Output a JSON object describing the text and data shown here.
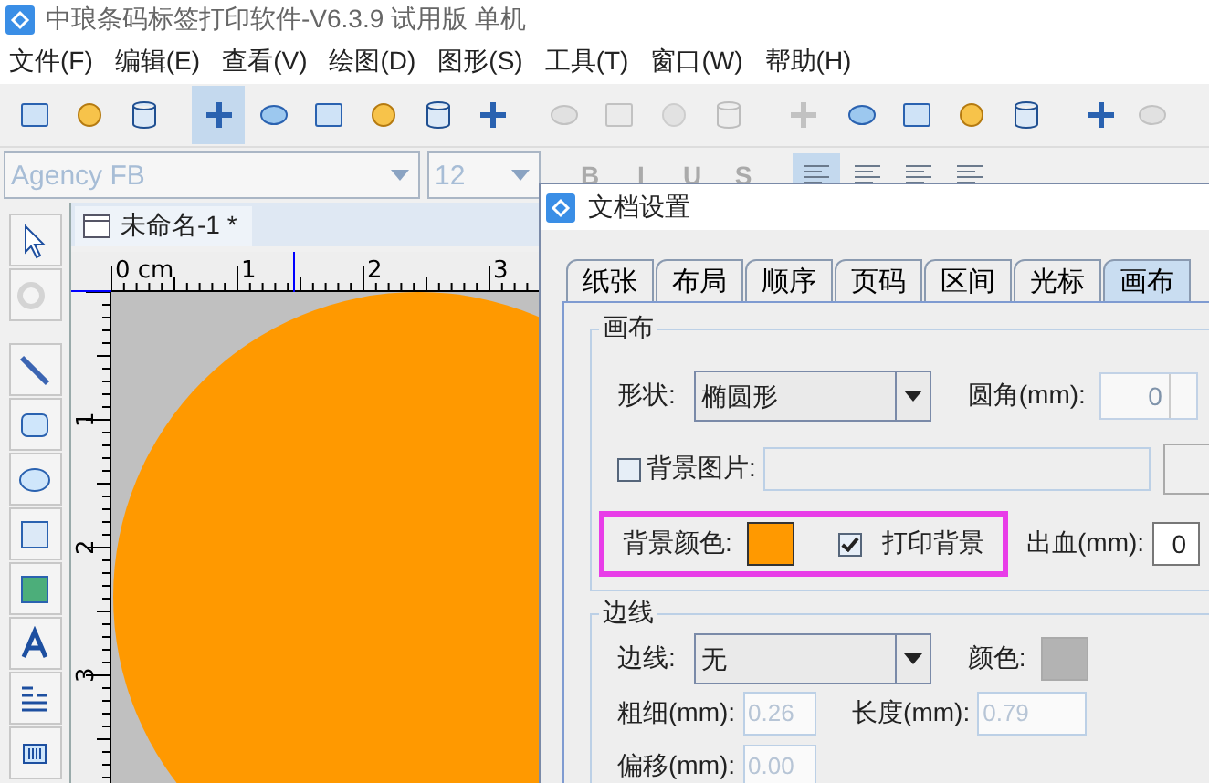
{
  "window": {
    "title": "中琅条码标签打印软件-V6.3.9 试用版 单机"
  },
  "menu": [
    "文件(F)",
    "编辑(E)",
    "查看(V)",
    "绘图(D)",
    "图形(S)",
    "工具(T)",
    "窗口(W)",
    "帮助(H)"
  ],
  "toolbar": [
    {
      "selected": false,
      "disabled": false
    },
    {
      "selected": false,
      "disabled": false
    },
    {
      "selected": false,
      "disabled": false
    },
    {
      "selected": true,
      "disabled": false
    },
    {
      "selected": false,
      "disabled": false
    },
    {
      "selected": false,
      "disabled": false
    },
    {
      "selected": false,
      "disabled": false
    },
    {
      "selected": false,
      "disabled": false
    },
    {
      "selected": false,
      "disabled": false
    },
    {
      "selected": false,
      "disabled": true
    },
    {
      "selected": false,
      "disabled": true
    },
    {
      "selected": false,
      "disabled": true
    },
    {
      "selected": false,
      "disabled": true
    },
    {
      "selected": false,
      "disabled": true
    },
    {
      "selected": false,
      "disabled": false
    },
    {
      "selected": false,
      "disabled": false
    },
    {
      "selected": false,
      "disabled": false
    },
    {
      "selected": false,
      "disabled": false
    },
    {
      "selected": false,
      "disabled": false
    },
    {
      "selected": false,
      "disabled": true
    }
  ],
  "format_bar": {
    "font": "Agency FB",
    "size": "12",
    "styles": [
      "B",
      "I",
      "U",
      "S"
    ],
    "align": [
      {
        "selected": true
      },
      {
        "selected": false
      },
      {
        "selected": false
      },
      {
        "selected": false
      }
    ]
  },
  "toolbox": [
    {
      "disabled": false
    },
    {
      "disabled": true
    },
    {
      "disabled": false
    },
    {
      "disabled": false
    },
    {
      "disabled": false
    },
    {
      "disabled": false
    },
    {
      "disabled": false
    },
    {
      "disabled": false
    },
    {
      "disabled": false
    },
    {
      "disabled": false
    }
  ],
  "document": {
    "tab": "未命名-1 *",
    "ruler_h": [
      "0 cm",
      "1",
      "2",
      "3"
    ],
    "ruler_v": [
      "1",
      "2",
      "3"
    ]
  },
  "dialog": {
    "title": "文档设置",
    "tabs": [
      {
        "label": "纸张",
        "selected": false
      },
      {
        "label": "布局",
        "selected": false
      },
      {
        "label": "顺序",
        "selected": false
      },
      {
        "label": "页码",
        "selected": false
      },
      {
        "label": "区间",
        "selected": false
      },
      {
        "label": "光标",
        "selected": false
      },
      {
        "label": "画布",
        "selected": true
      }
    ],
    "canvas_group": {
      "title": "画布",
      "shape_label": "形状:",
      "shape_value": "椭圆形",
      "corner_label": "圆角(mm):",
      "corner_value": "0",
      "bg_image_label": "背景图片:",
      "bg_image_checked": false,
      "bg_color_label": "背景颜色:",
      "color": "#ff9900",
      "print_bg_label": "打印背景",
      "print_bg_checked": true,
      "bleed_label": "出血(mm):",
      "bleed_value": "0"
    },
    "border_group": {
      "title": "边线",
      "border_label": "边线:",
      "border_value": "无",
      "color_label": "颜色:",
      "color": "#b3b3b3",
      "width_label": "粗细(mm):",
      "width_value": "0.26",
      "length_label": "长度(mm):",
      "length_value": "0.79",
      "offset_label": "偏移(mm):",
      "offset_value": "0.00"
    }
  }
}
